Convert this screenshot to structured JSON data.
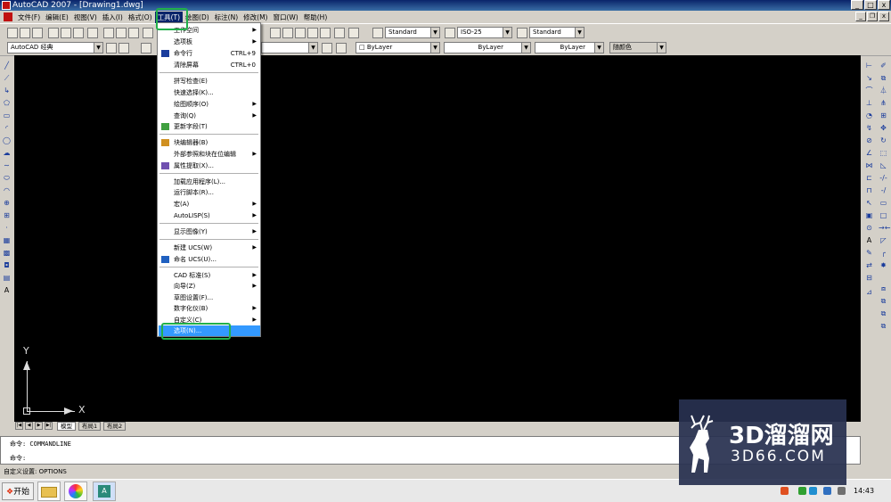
{
  "window": {
    "title": "AutoCAD 2007 - [Drawing1.dwg]",
    "min": "_",
    "max": "□",
    "close": "x"
  },
  "menubar": {
    "items": [
      "文件(F)",
      "编辑(E)",
      "视图(V)",
      "插入(I)",
      "格式(O)",
      "工具(T)",
      "绘图(D)",
      "标注(N)",
      "修改(M)",
      "窗口(W)",
      "帮助(H)"
    ],
    "active_index": 5
  },
  "toolbar": {
    "workspace": "AutoCAD 经典",
    "text_style": "Standard",
    "dim_style": "ISO-25",
    "table_style": "Standard",
    "layer_color": "ByLayer",
    "linetype": "ByLayer",
    "lineweight": "ByLayer",
    "plot_style": "随颜色"
  },
  "tools_menu": {
    "items": [
      {
        "label": "工作空间",
        "submenu": true
      },
      {
        "label": "选项板",
        "submenu": true
      },
      {
        "label": "命令行",
        "shortcut": "CTRL+9",
        "icon": "cmdline-icon"
      },
      {
        "label": "清除屏幕",
        "shortcut": "CTRL+0"
      },
      {
        "label": "拼写检查(E)"
      },
      {
        "label": "快速选择(K)..."
      },
      {
        "label": "绘图顺序(O)",
        "submenu": true
      },
      {
        "label": "查询(Q)",
        "submenu": true
      },
      {
        "label": "更新字段(T)",
        "icon": "update-field-icon"
      },
      {
        "label": "块编辑器(B)",
        "icon": "block-editor-icon"
      },
      {
        "label": "外部参照和块在位编辑",
        "submenu": true
      },
      {
        "label": "属性提取(X)...",
        "icon": "attribute-extract-icon"
      },
      {
        "label": "加载应用程序(L)..."
      },
      {
        "label": "运行脚本(R)..."
      },
      {
        "label": "宏(A)",
        "submenu": true
      },
      {
        "label": "AutoLISP(S)",
        "submenu": true
      },
      {
        "label": "显示图像(Y)",
        "submenu": true
      },
      {
        "label": "新建 UCS(W)",
        "submenu": true
      },
      {
        "label": "命名 UCS(U)...",
        "icon": "named-ucs-icon"
      },
      {
        "label": "CAD 标准(S)",
        "submenu": true
      },
      {
        "label": "向导(Z)",
        "submenu": true
      },
      {
        "label": "草图设置(F)..."
      },
      {
        "label": "数字化仪(B)",
        "submenu": true
      },
      {
        "label": "自定义(C)",
        "submenu": true
      },
      {
        "label": "选项(N)...",
        "selected": true
      }
    ]
  },
  "canvas": {
    "ucs_y": "Y",
    "ucs_x": "X"
  },
  "layout_tabs": [
    "模型",
    "布局1",
    "布局2"
  ],
  "command": {
    "line1": "命令: COMMANDLINE",
    "line2": "命令:"
  },
  "status": "自定义设置:  OPTIONS",
  "taskbar": {
    "start": "开始",
    "clock": "14:43"
  },
  "watermark": {
    "big": "3D溜溜网",
    "small": "3D66.COM"
  },
  "colors": {
    "highlight": "#22b04a",
    "selected": "#3399ff",
    "menu_active": "#0a246a"
  }
}
